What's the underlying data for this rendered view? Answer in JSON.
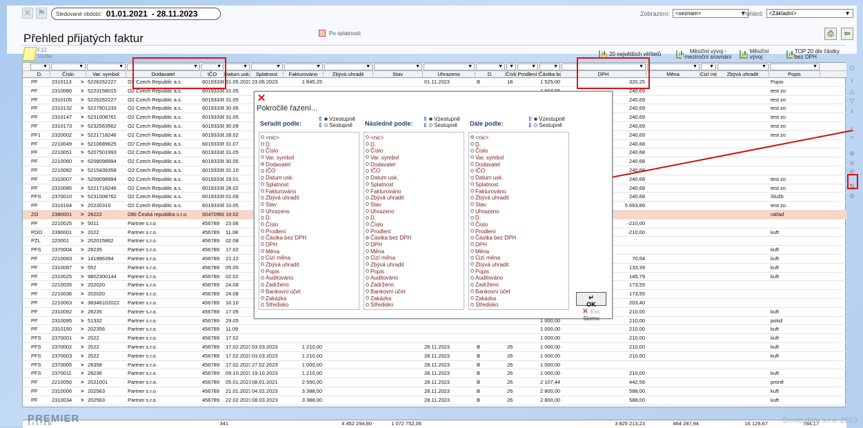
{
  "topbar": {
    "period_label": "Sledované období:",
    "period_from": "01.01.2021",
    "period_to": "- 28.11.2023",
    "zobrazeni_label": "Zobrazení:",
    "zobrazeni_value": "<seznam>",
    "pohled_label": "Pohled:",
    "pohled_value": "<Základní>"
  },
  "page_title": "Přehled přijatých faktur",
  "po_splatnosti": "Po splatnosti",
  "f12_label": "F12",
  "vazby_label": "Vazby",
  "report_buttons": [
    "20 největších věřitelů",
    "Měsíční vývoj - meziroční srovnání",
    "Měsíční vývoj",
    "TOP 20 dle částky bez DPH"
  ],
  "columns": [
    "D.",
    "Číslo",
    "Var. symbol",
    "Dodavatel",
    "IČO",
    "Datum usk.",
    "Splatnost",
    "Fakturováno",
    "Zbývá uhradit",
    "Stav",
    "Uhrazeno",
    "D.",
    "Číslo",
    "Prodlení",
    "Částka bez DPH",
    "DPH",
    "Měna",
    "Cizí měna",
    "Zbývá uhradit",
    "Popis"
  ],
  "rows": [
    [
      "PF",
      "2310113",
      "5226262227",
      "O2 Czech Republic a.s.",
      "60193336",
      "31.05.2023",
      "23.06.2023",
      "1 845,25",
      "",
      "",
      "01.11.2023",
      "B",
      "18",
      "",
      "1 525,00",
      "320,25",
      "",
      "",
      "",
      "Popis"
    ],
    [
      "PF",
      "2310080",
      "5223158015",
      "O2 Czech Republic a.s.",
      "60193336",
      "31.05",
      "",
      "",
      "",
      "",
      "",
      "",
      "",
      "",
      "1 604,56",
      "240,69",
      "",
      "",
      "",
      "test zo"
    ],
    [
      "PF",
      "2310105",
      "5226262227",
      "O2 Czech Republic a.s.",
      "60193336",
      "31.05",
      "",
      "",
      "",
      "",
      "",
      "",
      "",
      "",
      "1 604,56",
      "240,69",
      "",
      "",
      "",
      "test zo"
    ],
    [
      "PF",
      "2310132",
      "5227901233",
      "O2 Czech Republic a.s.",
      "60193336",
      "30.06",
      "",
      "",
      "",
      "",
      "",
      "",
      "",
      "",
      "1 604,56",
      "240,69",
      "",
      "",
      "",
      "test zo"
    ],
    [
      "PF",
      "2310147",
      "5231008761",
      "O2 Czech Republic a.s.",
      "60193336",
      "31.05",
      "",
      "",
      "",
      "",
      "",
      "",
      "",
      "",
      "1 604,56",
      "240,69",
      "",
      "",
      "",
      "test zo"
    ],
    [
      "PF",
      "2310173",
      "5232563562",
      "O2 Czech Republic a.s.",
      "60193336",
      "30.09",
      "",
      "",
      "",
      "",
      "",
      "",
      "",
      "",
      "1 604,56",
      "240,69",
      "",
      "",
      "",
      "test zo"
    ],
    [
      "PF1",
      "2320002",
      "5221718246",
      "O2 Czech Republic a.s.",
      "60193336",
      "28.02",
      "",
      "",
      "",
      "",
      "",
      "",
      "",
      "",
      "1 604,56",
      "240,69",
      "",
      "",
      "",
      "test zo"
    ],
    [
      "PF",
      "2210049",
      "5210689625",
      "O2 Czech Republic a.s.",
      "60193336",
      "31.07",
      "",
      "",
      "",
      "",
      "",
      "",
      "",
      "",
      "1 604,57",
      "240,68",
      "",
      "",
      "",
      ""
    ],
    [
      "PF",
      "2210051",
      "5207501993",
      "O2 Czech Republic a.s.",
      "60193336",
      "31.05",
      "",
      "",
      "",
      "",
      "",
      "",
      "",
      "",
      "1 604,57",
      "240,68",
      "",
      "",
      "",
      ""
    ],
    [
      "PF",
      "2210060",
      "5209098994",
      "O2 Czech Republic a.s.",
      "60193336",
      "30.06",
      "",
      "",
      "",
      "",
      "",
      "",
      "",
      "",
      "1 604,57",
      "240,68",
      "",
      "",
      "",
      ""
    ],
    [
      "PF",
      "2210082",
      "5215439358",
      "O2 Czech Republic a.s.",
      "60193336",
      "31.10",
      "",
      "",
      "",
      "",
      "",
      "",
      "",
      "",
      "1 604,57",
      "240,68",
      "",
      "",
      "",
      ""
    ],
    [
      "PF",
      "2310007",
      "5209098994",
      "O2 Czech Republic a.s.",
      "60193336",
      "19.01",
      "",
      "",
      "",
      "",
      "",
      "",
      "",
      "",
      "1 604,57",
      "240,68",
      "",
      "",
      "",
      "test zo"
    ],
    [
      "PF",
      "2310085",
      "5221718246",
      "O2 Czech Republic a.s.",
      "60193336",
      "28.02",
      "",
      "",
      "",
      "",
      "",
      "",
      "",
      "",
      "1 604,57",
      "240,68",
      "",
      "",
      "",
      "test zo"
    ],
    [
      "PFS",
      "2370010",
      "5231008762",
      "O2 Czech Republic a.s.",
      "60193336",
      "01.09",
      "",
      "",
      "",
      "",
      "",
      "",
      "",
      "",
      "1 604,57",
      "240,68",
      "",
      "",
      "",
      "Služb"
    ],
    [
      "PF",
      "2310164",
      "20230310",
      "O2 Czech Republic a.s.",
      "60193336",
      "10.05",
      "",
      "",
      "",
      "",
      "",
      "",
      "",
      "",
      "26 970,90",
      "5 663,89",
      "",
      "",
      "",
      "test zo"
    ],
    [
      "ZO",
      "2380001",
      "28222",
      "OBI Česká republika s.r.o.",
      "60470968",
      "19.02",
      "",
      "",
      "",
      "",
      "",
      "",
      "",
      "",
      "656,00",
      "",
      "",
      "",
      "",
      "nářad"
    ],
    [
      "PF",
      "2210025",
      "5011",
      "Partner s.r.o.",
      "456789",
      "23.06",
      "",
      "",
      "",
      "",
      "",
      "",
      "",
      "",
      "-1 000,00",
      "-210,00",
      "",
      "",
      "",
      ""
    ],
    [
      "PDO",
      "2390001",
      "2022",
      "Partner s.r.o.",
      "456789",
      "11.08",
      "",
      "",
      "",
      "",
      "",
      "",
      "",
      "",
      "-1 000,00",
      "-210,00",
      "",
      "",
      "",
      "kuft"
    ],
    [
      "PZL",
      "220001",
      "202015862",
      "Partner s.r.o.",
      "456789",
      "02.08",
      "",
      "",
      "",
      "",
      "",
      "",
      "",
      "",
      "",
      "",
      "",
      "",
      "",
      ""
    ],
    [
      "PFS",
      "2370004",
      "28235",
      "Partner s.r.o.",
      "456789",
      "17.02",
      "",
      "",
      "",
      "",
      "",
      "",
      "",
      "",
      "",
      "",
      "",
      "",
      "",
      "kuft"
    ],
    [
      "PF",
      "2210083",
      "141986394",
      "Partner s.r.o.",
      "456789",
      "21.12",
      "",
      "",
      "",
      "",
      "",
      "",
      "",
      "",
      "336,36",
      "70,64",
      "",
      "",
      "",
      "kuft"
    ],
    [
      "PF",
      "2310087",
      "552",
      "Partner s.r.o.",
      "456789",
      "05.05",
      "",
      "",
      "",
      "",
      "",
      "",
      "",
      "",
      "635,20",
      "133,39",
      "",
      "",
      "",
      "kuft"
    ],
    [
      "PF",
      "2310025",
      "9802300144",
      "Partner s.r.o.",
      "456789",
      "02.02",
      "",
      "",
      "",
      "",
      "",
      "",
      "",
      "",
      "694,21",
      "145,79",
      "",
      "",
      "",
      "kuft"
    ],
    [
      "PF",
      "2210035",
      "202020",
      "Partner s.r.o.",
      "456789",
      "24.08",
      "",
      "",
      "",
      "",
      "",
      "",
      "",
      "",
      "826,45",
      "173,55",
      "",
      "",
      "",
      ""
    ],
    [
      "PF",
      "2210036",
      "202020",
      "Partner s.r.o.",
      "456789",
      "24.08",
      "",
      "",
      "",
      "",
      "",
      "",
      "",
      "",
      "826,45",
      "173,55",
      "",
      "",
      "",
      ""
    ],
    [
      "PF",
      "2210063",
      "38346102022",
      "Partner s.r.o.",
      "456789",
      "16.10",
      "",
      "",
      "",
      "",
      "",
      "",
      "",
      "",
      "968,60",
      "203,40",
      "",
      "",
      "",
      ""
    ],
    [
      "PF",
      "2310092",
      "28235",
      "Partner s.r.o.",
      "456789",
      "17.05",
      "",
      "",
      "",
      "",
      "",
      "",
      "",
      "",
      "1 000,00",
      "210,00",
      "",
      "",
      "",
      "kuft"
    ],
    [
      "PF",
      "2310095",
      "51332",
      "Partner s.r.o.",
      "456789",
      "29.05",
      "",
      "",
      "",
      "",
      "",
      "",
      "",
      "",
      "1 000,00",
      "210,00",
      "",
      "",
      "",
      "polož"
    ],
    [
      "PF",
      "2310150",
      "202356",
      "Partner s.r.o.",
      "456789",
      "11.09",
      "",
      "",
      "",
      "",
      "",
      "",
      "",
      "",
      "1 000,00",
      "210,00",
      "",
      "",
      "",
      "kuft"
    ],
    [
      "PFS",
      "2370001",
      "2022",
      "Partner s.r.o.",
      "456789",
      "17.02",
      "",
      "",
      "",
      "",
      "",
      "",
      "",
      "",
      "1 000,00",
      "210,00",
      "",
      "",
      "",
      "kuft"
    ],
    [
      "PFS",
      "2370002",
      "2022",
      "Partner s.r.o.",
      "456789",
      "17.02.2023",
      "03.03.2023",
      "1 210,00",
      "",
      "",
      "28.11.2023",
      "B",
      "26",
      "",
      "1 000,00",
      "210,00",
      "",
      "",
      "",
      "kuft"
    ],
    [
      "PFS",
      "2370003",
      "2022",
      "Partner s.r.o.",
      "456789",
      "17.02.2023",
      "03.03.2023",
      "1 210,00",
      "",
      "",
      "28.11.2023",
      "B",
      "26",
      "",
      "1 000,00",
      "210,00",
      "",
      "",
      "",
      "kuft"
    ],
    [
      "PFS",
      "2370005",
      "28358",
      "Partner s.r.o.",
      "456789",
      "17.02.2023",
      "27.02.2023",
      "1 000,00",
      "",
      "",
      "28.11.2023",
      "B",
      "26",
      "",
      "1 000,00",
      "",
      "",
      "",
      "",
      ""
    ],
    [
      "PFS",
      "2370011",
      "28236",
      "Partner s.r.o.",
      "456789",
      "09.10.2023",
      "19.10.2023",
      "1 210,00",
      "",
      "",
      "28.11.2023",
      "B",
      "26",
      "",
      "1 000,00",
      "210,00",
      "",
      "",
      "",
      "kuft"
    ],
    [
      "PF",
      "2210050",
      "2021001",
      "Partner s.r.o.",
      "456789",
      "05.01.2021",
      "08.01.2021",
      "2 550,00",
      "",
      "",
      "28.11.2023",
      "B",
      "26",
      "",
      "2 107,44",
      "442,56",
      "",
      "",
      "",
      "proně"
    ],
    [
      "PF",
      "2310006",
      "202563",
      "Partner s.r.o.",
      "456789",
      "21.01.2023",
      "04.02.2023",
      "3 388,00",
      "",
      "",
      "28.11.2023",
      "B",
      "26",
      "",
      "2 800,00",
      "588,00",
      "",
      "",
      "",
      "kuft"
    ],
    [
      "PF",
      "2310034",
      "202563",
      "Partner s.r.o.",
      "456789",
      "22.02.2023",
      "08.03.2023",
      "3 388,00",
      "",
      "",
      "28.11.2023",
      "B",
      "26",
      "",
      "2 800,00",
      "588,00",
      "",
      "",
      "",
      "kuft"
    ]
  ],
  "totals": {
    "count": "341",
    "fakturovano": "4 452 294,80",
    "zbyva": "1 072 752,06",
    "castka_bez_dph": "3 825 213,23",
    "dph": "464 287,94",
    "cizi_mena": "16 129,67",
    "zbyva2": "784,17"
  },
  "dialog": {
    "title": "Pokročilé řazení...",
    "col1_label": "Seřadit podle:",
    "col2_label": "Následně podle:",
    "col3_label": "Dále podle:",
    "asc": "Vzestupně",
    "desc": "Sestupně",
    "options": [
      "<nic>",
      "D.",
      "Číslo",
      "Var. symbol",
      "Dodavatel",
      "IČO",
      "Datum usk.",
      "Splatnost",
      "Fakturováno",
      "Zbývá uhradit",
      "Stav",
      "Uhrazeno",
      "D.",
      "Číslo",
      "Prodlení",
      "Částka bez DPH",
      "DPH",
      "Měna",
      "Cizí měna",
      "Zbývá uhradit",
      "Popis",
      "Auditováno",
      "Zadrženo",
      "Bankovní účet",
      "Zakázka",
      "Středisko"
    ],
    "selected": [
      4,
      15,
      0
    ],
    "ok_label": "OK",
    "storno_label": "Storno",
    "esc_label": "Esc"
  },
  "footer": {
    "logo": "PREMIER",
    "logo_sub": "SYSTEM",
    "demo": "Demo data s.r.o. 2023"
  },
  "colors": {
    "highlight_row": "#f9d6c6",
    "annotation_red": "#e01010",
    "sort_arrow": "#2b62c9"
  }
}
